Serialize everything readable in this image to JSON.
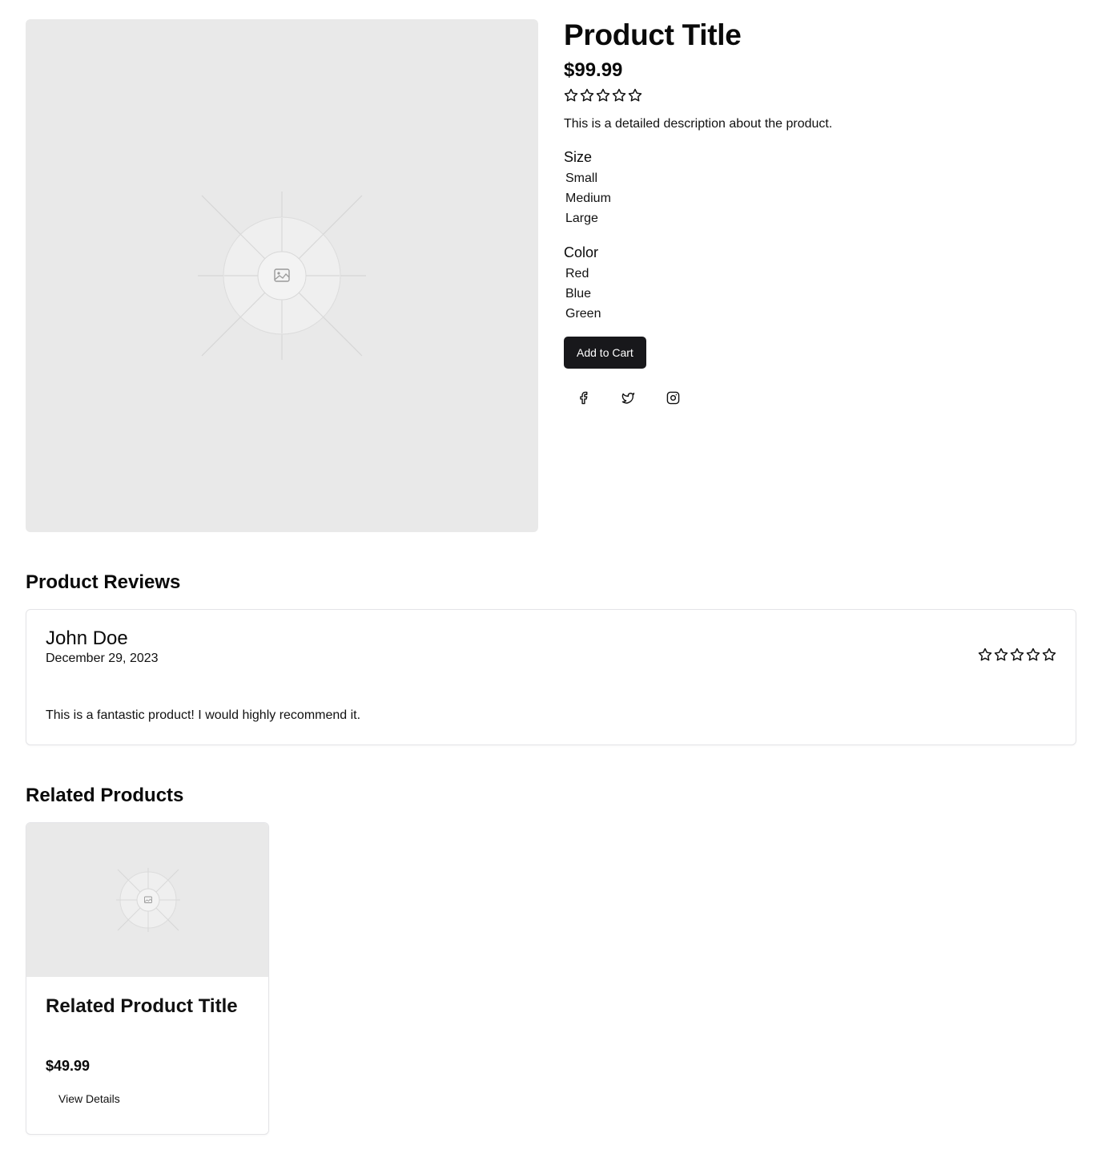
{
  "product": {
    "title": "Product Title",
    "price": "$99.99",
    "rating": 0,
    "rating_max": 5,
    "description": "This is a detailed description about the product.",
    "size": {
      "label": "Size",
      "options": [
        "Small",
        "Medium",
        "Large"
      ]
    },
    "color": {
      "label": "Color",
      "options": [
        "Red",
        "Blue",
        "Green"
      ]
    },
    "add_to_cart_label": "Add to Cart",
    "social_icons": [
      "facebook-icon",
      "twitter-icon",
      "instagram-icon"
    ]
  },
  "reviews": {
    "heading": "Product Reviews",
    "items": [
      {
        "name": "John Doe",
        "date": "December 29, 2023",
        "rating": 0,
        "rating_max": 5,
        "text": "This is a fantastic product! I would highly recommend it."
      }
    ]
  },
  "related": {
    "heading": "Related Products",
    "items": [
      {
        "title": "Related Product Title",
        "price": "$49.99",
        "button_label": "View Details"
      }
    ]
  },
  "colors": {
    "button_bg": "#18181b",
    "placeholder_bg": "#e9e9e9",
    "border": "#e4e4e7"
  }
}
